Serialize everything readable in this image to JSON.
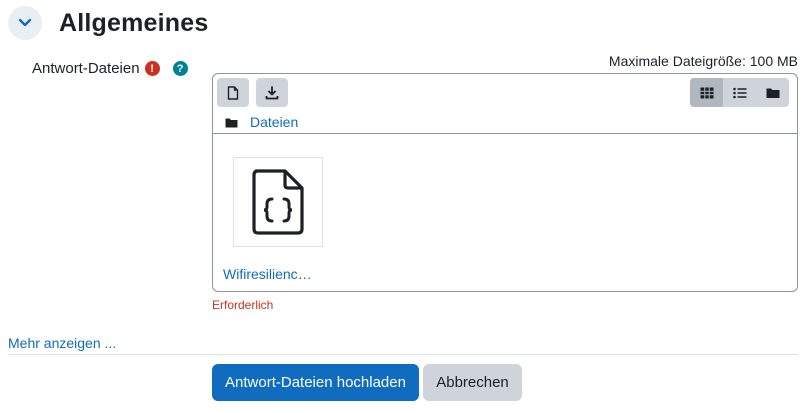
{
  "section": {
    "title": "Allgemeines"
  },
  "field": {
    "label": "Antwort-Dateien",
    "required_icon_glyph": "!",
    "help_icon_glyph": "?"
  },
  "filepicker": {
    "max_size": "Maximale Dateigröße: 100 MB",
    "path_label": "Dateien",
    "files": [
      {
        "name": "Wifiresilienc…",
        "icon": "file-code-icon"
      }
    ]
  },
  "validation": {
    "required_message": "Erforderlich"
  },
  "more_link": "Mehr anzeigen ...",
  "actions": {
    "submit_label": "Antwort-Dateien hochladen",
    "cancel_label": "Abbrechen"
  },
  "colors": {
    "primary": "#0f6cbf",
    "danger": "#ca3120",
    "info": "#008196",
    "secondary": "#ced4da"
  }
}
